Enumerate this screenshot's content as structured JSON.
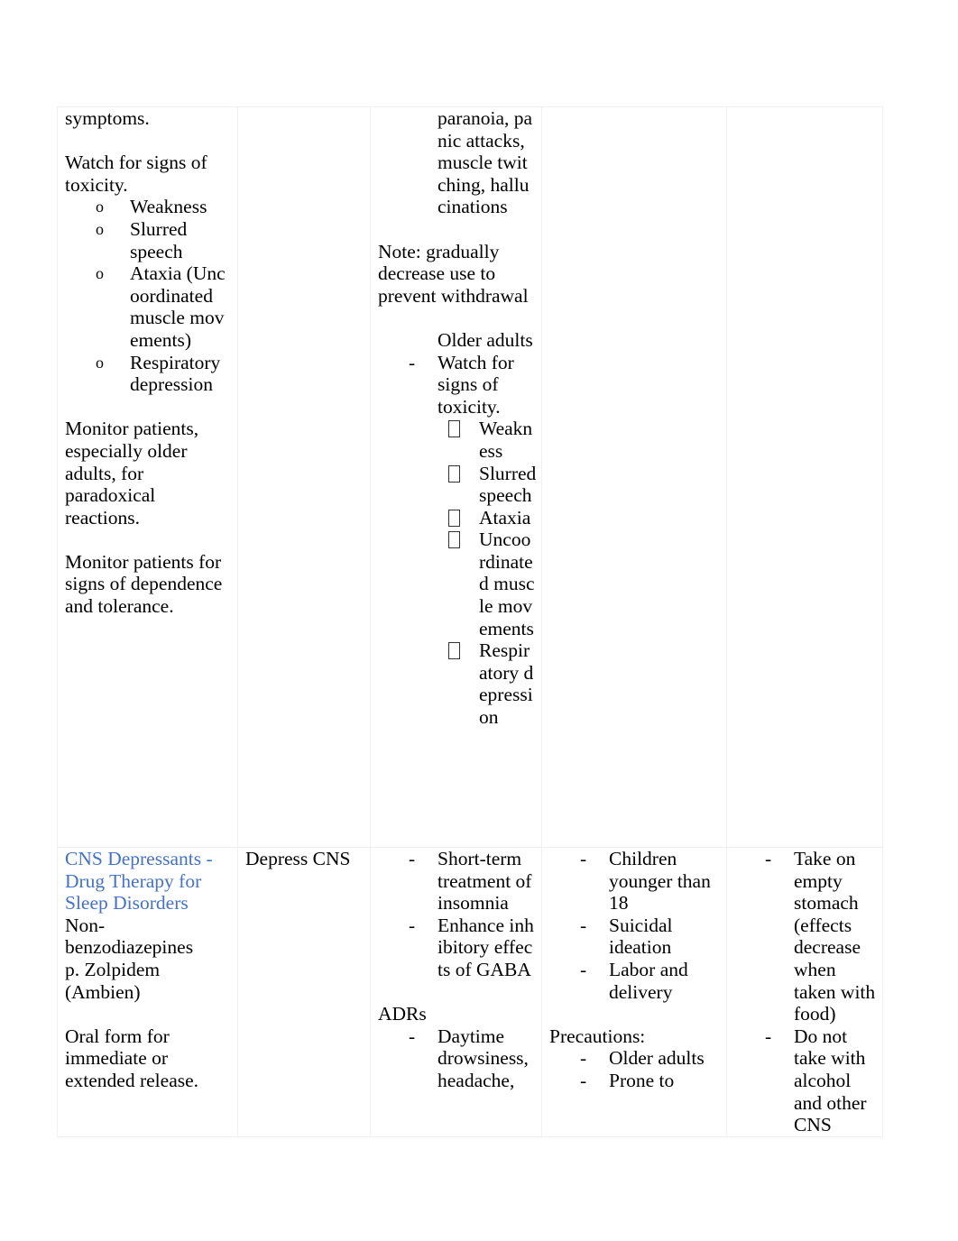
{
  "document": {
    "kind": "word-document-page",
    "accent_color": "#4472C4",
    "body_color": "#000000",
    "page_background": "#FFFFFF",
    "border_color": "#F0F0F0"
  },
  "table": {
    "columns": 5,
    "rows": [
      {
        "id": "row-continued",
        "cells": {
          "col1": {
            "blocks": [
              {
                "type": "paragraph",
                "text": "symptoms."
              },
              {
                "type": "blank"
              },
              {
                "type": "paragraph",
                "text": "Watch for signs of toxicity."
              },
              {
                "type": "list",
                "marker": "o",
                "items": [
                  "Weakness",
                  "Slurred speech",
                  "Ataxia (Uncoordinated muscle movements)",
                  "Respiratory depression"
                ]
              },
              {
                "type": "blank"
              },
              {
                "type": "paragraph",
                "text": "Monitor patients, especially older adults, for paradoxical reactions."
              },
              {
                "type": "blank"
              },
              {
                "type": "paragraph",
                "text": "Monitor patients for signs of dependence and tolerance."
              }
            ]
          },
          "col2": {
            "blocks": []
          },
          "col3": {
            "blocks": [
              {
                "type": "paragraph-indent",
                "text": "paranoia, panic attacks, muscle twitching, hallucinations"
              },
              {
                "type": "blank"
              },
              {
                "type": "paragraph",
                "text": "Note:  gradually decrease use to prevent withdrawal"
              },
              {
                "type": "blank"
              },
              {
                "type": "list-nomarker",
                "text": "Older adults"
              },
              {
                "type": "list",
                "marker": "-",
                "items": [
                  "Watch for signs of toxicity."
                ]
              },
              {
                "type": "list2",
                "marker": "wingding-box",
                "items": [
                  "Weakness",
                  "Slurred speech",
                  "Ataxia",
                  "Uncoordinated muscle movements",
                  "Respiratory depression"
                ]
              }
            ]
          },
          "col4": {
            "blocks": []
          },
          "col5": {
            "blocks": []
          }
        }
      },
      {
        "id": "row-cns-depressants",
        "cells": {
          "col1": {
            "blocks": [
              {
                "type": "heading",
                "text": "CNS Depressants - Drug Therapy for Sleep Disorders",
                "color": "#4472C4"
              },
              {
                "type": "paragraph",
                "text": "Non-benzodiazepines"
              },
              {
                "type": "paragraph",
                "text": "p. Zolpidem (Ambien)"
              },
              {
                "type": "blank"
              },
              {
                "type": "paragraph",
                "text": "Oral form for immediate or extended release."
              }
            ]
          },
          "col2": {
            "blocks": [
              {
                "type": "paragraph",
                "text": "Depress CNS"
              }
            ]
          },
          "col3": {
            "blocks": [
              {
                "type": "list",
                "marker": "-",
                "items": [
                  "Short-term treatment of insomnia",
                  "Enhance inhibitory effects of GABA"
                ]
              },
              {
                "type": "blank"
              },
              {
                "type": "paragraph",
                "text": "ADRs"
              },
              {
                "type": "list",
                "marker": "-",
                "items": [
                  "Daytime drowsiness, headache,"
                ]
              }
            ]
          },
          "col4": {
            "blocks": [
              {
                "type": "list",
                "marker": "-",
                "items": [
                  "Children younger than 18",
                  "Suicidal ideation",
                  "Labor and delivery"
                ]
              },
              {
                "type": "blank"
              },
              {
                "type": "paragraph",
                "text": "Precautions:"
              },
              {
                "type": "list",
                "marker": "-",
                "items": [
                  "Older adults",
                  "Prone to"
                ]
              }
            ]
          },
          "col5": {
            "blocks": [
              {
                "type": "list",
                "marker": "-",
                "items": [
                  "Take on empty stomach (effects decrease when taken with food)",
                  "Do not take with alcohol and other CNS"
                ]
              }
            ]
          }
        }
      }
    ]
  }
}
